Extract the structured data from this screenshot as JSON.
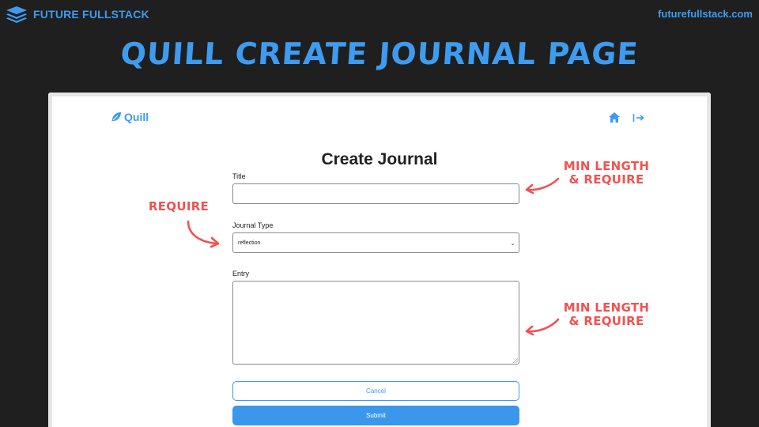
{
  "slide": {
    "brand": "FUTURE FULLSTACK",
    "site_url": "futurefullstack.com",
    "title": "QUILL CREATE JOURNAL PAGE"
  },
  "app": {
    "logo_text": "Quill",
    "nav": {
      "home_icon": "home-icon",
      "logout_icon": "logout-icon"
    },
    "form": {
      "heading": "Create Journal",
      "title_label": "Title",
      "title_value": "",
      "type_label": "Journal Type",
      "type_selected": "reflection",
      "entry_label": "Entry",
      "entry_value": "",
      "cancel_label": "Cancel",
      "submit_label": "Submit"
    }
  },
  "annotations": {
    "title_note_line1": "MIN LENGTH",
    "title_note_line2": "& REQUIRE",
    "type_note": "REQUIRE",
    "entry_note_line1": "MIN LENGTH",
    "entry_note_line2": "& REQUIRE"
  },
  "colors": {
    "brand_blue": "#3d9cf0",
    "annotation_red": "#ef5350",
    "background": "#1f1f1f"
  }
}
